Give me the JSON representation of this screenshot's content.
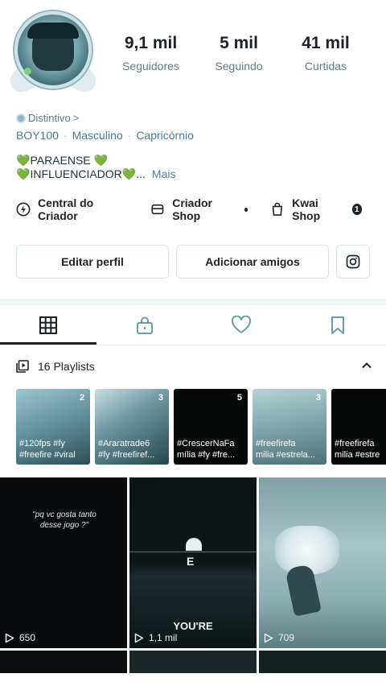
{
  "profile": {
    "stats": [
      {
        "value": "9,1 mil",
        "label": "Seguidores"
      },
      {
        "value": "5 mil",
        "label": "Seguindo"
      },
      {
        "value": "41 mil",
        "label": "Curtidas"
      }
    ],
    "badge_label": "Distintivo",
    "badge_chevron": ">",
    "info": [
      "BOY100",
      "Masculino",
      "Capricórnio"
    ],
    "bio_line1": "PARAENSE",
    "bio_line2": "INFLUENCIADOR",
    "bio_ellipsis": "...",
    "bio_more": "Mais",
    "heart_glyph": "💚"
  },
  "creator_links": {
    "central": "Central do Criador",
    "shop": "Criador Shop",
    "kwai": "Kwai Shop",
    "kwai_count": "1"
  },
  "buttons": {
    "edit": "Editar perfil",
    "add": "Adicionar amigos"
  },
  "tabs": [
    "videos-grid",
    "private-lock",
    "liked-heart",
    "saved-bookmark"
  ],
  "playlists": {
    "header": "16 Playlists",
    "items": [
      {
        "count": "2",
        "line1": "#120fps #fy",
        "line2": "#freefire #viral"
      },
      {
        "count": "3",
        "line1": "#Araratrade6",
        "line2": "#fy #freefiref..."
      },
      {
        "count": "5",
        "line1": "#CrescerNaFa",
        "line2": "mília #fy #fre..."
      },
      {
        "count": "3",
        "line1": "#freefirefa",
        "line2": "milia #estrela..."
      },
      {
        "count": "",
        "line1": "#freefirefa",
        "line2": "milia #estre"
      }
    ]
  },
  "videos": [
    {
      "views": "650",
      "caption": "\"pq vc gosta tanto desse jogo ?\""
    },
    {
      "views": "1,1 mil",
      "overlay_top": "E",
      "overlay_bottom": "YOU'RE"
    },
    {
      "views": "709"
    }
  ],
  "colors": {
    "accent_text": "#5e7b85",
    "dark_text": "#1d2226",
    "divider": "#eef3f4"
  }
}
